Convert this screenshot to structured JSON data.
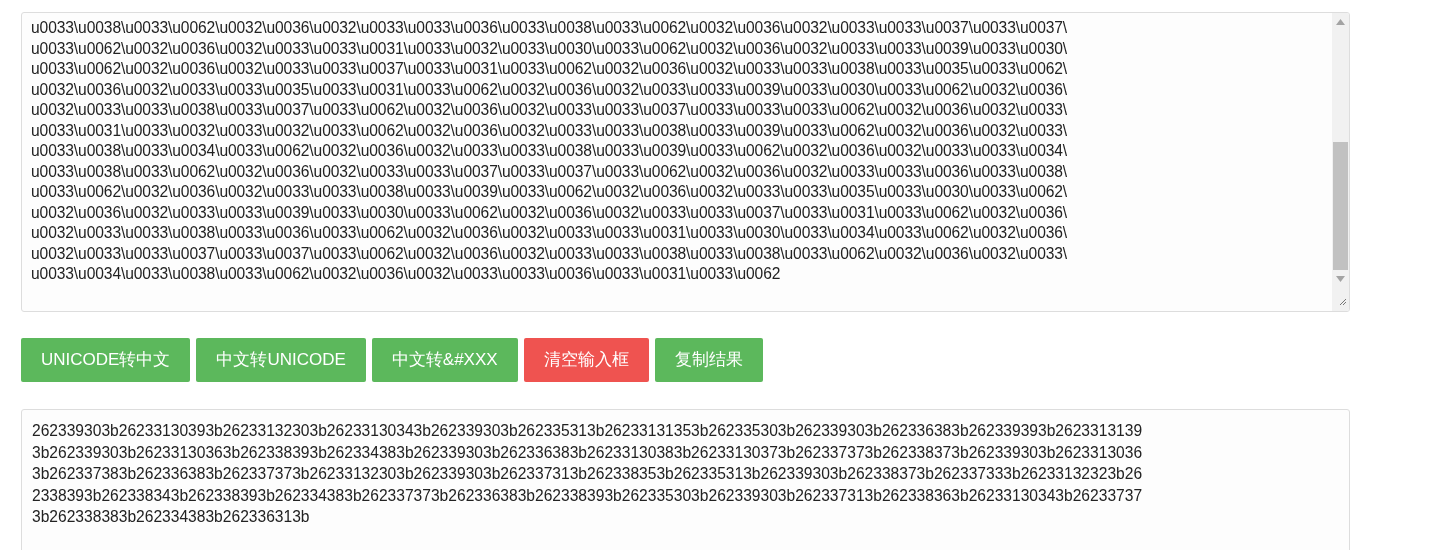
{
  "input": {
    "lines": [
      "u0033\\u0038\\u0033\\u0062\\u0032\\u0036\\u0032\\u0033\\u0033\\u0036\\u0033\\u0038\\u0033\\u0062\\u0032\\u0036\\u0032\\u0033\\u0033\\u0037\\u0033\\u0037\\",
      "u0033\\u0062\\u0032\\u0036\\u0032\\u0033\\u0033\\u0031\\u0033\\u0032\\u0033\\u0030\\u0033\\u0062\\u0032\\u0036\\u0032\\u0033\\u0033\\u0039\\u0033\\u0030\\",
      "u0033\\u0062\\u0032\\u0036\\u0032\\u0033\\u0033\\u0037\\u0033\\u0031\\u0033\\u0062\\u0032\\u0036\\u0032\\u0033\\u0033\\u0038\\u0033\\u0035\\u0033\\u0062\\",
      "u0032\\u0036\\u0032\\u0033\\u0033\\u0035\\u0033\\u0031\\u0033\\u0062\\u0032\\u0036\\u0032\\u0033\\u0033\\u0039\\u0033\\u0030\\u0033\\u0062\\u0032\\u0036\\",
      "u0032\\u0033\\u0033\\u0038\\u0033\\u0037\\u0033\\u0062\\u0032\\u0036\\u0032\\u0033\\u0033\\u0037\\u0033\\u0033\\u0033\\u0062\\u0032\\u0036\\u0032\\u0033\\",
      "u0033\\u0031\\u0033\\u0032\\u0033\\u0032\\u0033\\u0062\\u0032\\u0036\\u0032\\u0033\\u0033\\u0038\\u0033\\u0039\\u0033\\u0062\\u0032\\u0036\\u0032\\u0033\\",
      "u0033\\u0038\\u0033\\u0034\\u0033\\u0062\\u0032\\u0036\\u0032\\u0033\\u0033\\u0038\\u0033\\u0039\\u0033\\u0062\\u0032\\u0036\\u0032\\u0033\\u0033\\u0034\\",
      "u0033\\u0038\\u0033\\u0062\\u0032\\u0036\\u0032\\u0033\\u0033\\u0037\\u0033\\u0037\\u0033\\u0062\\u0032\\u0036\\u0032\\u0033\\u0033\\u0036\\u0033\\u0038\\",
      "u0033\\u0062\\u0032\\u0036\\u0032\\u0033\\u0033\\u0038\\u0033\\u0039\\u0033\\u0062\\u0032\\u0036\\u0032\\u0033\\u0033\\u0035\\u0033\\u0030\\u0033\\u0062\\",
      "u0032\\u0036\\u0032\\u0033\\u0033\\u0039\\u0033\\u0030\\u0033\\u0062\\u0032\\u0036\\u0032\\u0033\\u0033\\u0037\\u0033\\u0031\\u0033\\u0062\\u0032\\u0036\\",
      "u0032\\u0033\\u0033\\u0038\\u0033\\u0036\\u0033\\u0062\\u0032\\u0036\\u0032\\u0033\\u0033\\u0031\\u0033\\u0030\\u0033\\u0034\\u0033\\u0062\\u0032\\u0036\\",
      "u0032\\u0033\\u0033\\u0037\\u0033\\u0037\\u0033\\u0062\\u0032\\u0036\\u0032\\u0033\\u0033\\u0038\\u0033\\u0038\\u0033\\u0062\\u0032\\u0036\\u0032\\u0033\\",
      "u0033\\u0034\\u0033\\u0038\\u0033\\u0062\\u0032\\u0036\\u0032\\u0033\\u0033\\u0036\\u0033\\u0031\\u0033\\u0062"
    ]
  },
  "buttons": [
    {
      "label": "UNICODE转中文",
      "kind": "primary"
    },
    {
      "label": "中文转UNICODE",
      "kind": "primary"
    },
    {
      "label": "中文转&#XXX",
      "kind": "primary"
    },
    {
      "label": "清空输入框",
      "kind": "danger"
    },
    {
      "label": "复制结果",
      "kind": "primary"
    }
  ],
  "output": {
    "lines": [
      "262339303b26233130393b26233132303b26233130343b262339303b262335313b26233131353b262335303b262339303b262336383b262339393b2623313139",
      "3b262339303b26233130363b262338393b262334383b262339303b262336383b26233130383b26233130373b262337373b262338373b262339303b2623313036",
      "3b262337383b262336383b262337373b26233132303b262339303b262337313b262338353b262335313b262339303b262338373b262337333b26233132323b26",
      "2338393b262338343b262338393b262334383b262337373b262336383b262338393b262335303b262339303b262337313b262338363b26233130343b26233737",
      "3b262338383b262334383b262336313b"
    ]
  }
}
